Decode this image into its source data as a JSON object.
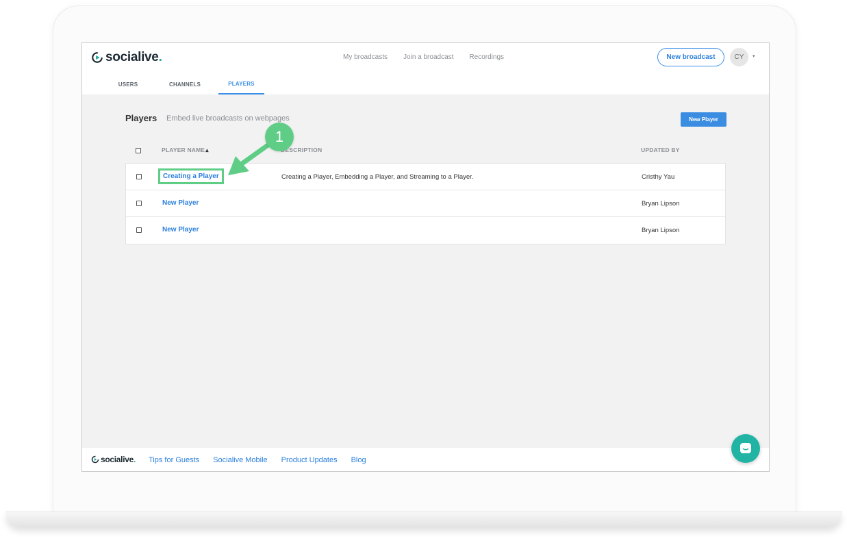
{
  "app": {
    "logo_text": "socialive",
    "logo_dot": ".",
    "accent_color": "#3a8ee6",
    "brand_color": "#20a99a"
  },
  "topnav": {
    "items": [
      "My broadcasts",
      "Join a broadcast",
      "Recordings"
    ],
    "new_broadcast_label": "New broadcast",
    "avatar_initials": "CY",
    "avatar_caret": "▾"
  },
  "subtabs": {
    "items": [
      "USERS",
      "CHANNELS",
      "PLAYERS"
    ],
    "active": "PLAYERS"
  },
  "players": {
    "title": "Players",
    "subtitle": "Embed live broadcasts on webpages",
    "new_player_label": "New Player"
  },
  "table": {
    "columns": {
      "name": "PLAYER NAME",
      "name_sort_icon": "▴",
      "description": "DESCRIPTION",
      "updated_by": "UPDATED BY"
    },
    "rows": [
      {
        "name": "Creating a Player",
        "description": "Creating a Player, Embedding a Player, and Streaming to a Player.",
        "updated_by": "Cristhy Yau"
      },
      {
        "name": "New Player",
        "description": "",
        "updated_by": "Bryan Lipson"
      },
      {
        "name": "New Player",
        "description": "",
        "updated_by": "Bryan Lipson"
      }
    ]
  },
  "annotation": {
    "step_number": "1",
    "color": "#5fcd86"
  },
  "footer": {
    "links": [
      "Tips for Guests",
      "Socialive Mobile",
      "Product Updates",
      "Blog"
    ]
  },
  "icons": {
    "chat": "chat-bubble-icon",
    "logo": "play-logo-icon"
  }
}
